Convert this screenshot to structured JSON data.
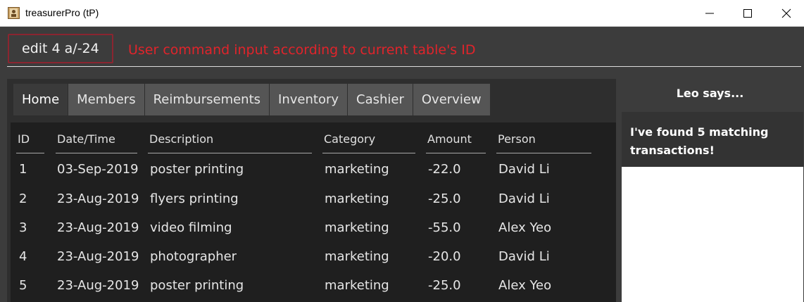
{
  "window": {
    "title": "treasurerPro (tP)",
    "icons": [
      "app-icon",
      "minimize-icon",
      "maximize-icon",
      "close-icon"
    ]
  },
  "command": {
    "value": "edit 4 a/-24",
    "annotation": "User command input according to current table's ID"
  },
  "tabs": [
    {
      "label": "Home",
      "active": true
    },
    {
      "label": "Members",
      "active": false
    },
    {
      "label": "Reimbursements",
      "active": false
    },
    {
      "label": "Inventory",
      "active": false
    },
    {
      "label": "Cashier",
      "active": false
    },
    {
      "label": "Overview",
      "active": false
    }
  ],
  "table": {
    "columns": [
      "ID",
      "Date/Time",
      "Description",
      "Category",
      "Amount",
      "Person"
    ],
    "rows": [
      [
        "1",
        "03-Sep-2019",
        "poster printing",
        "marketing",
        "-22.0",
        "David Li"
      ],
      [
        "2",
        "23-Aug-2019",
        "flyers printing",
        "marketing",
        "-25.0",
        "David Li"
      ],
      [
        "3",
        "23-Aug-2019",
        "video filming",
        "marketing",
        "-55.0",
        "Alex Yeo"
      ],
      [
        "4",
        "23-Aug-2019",
        "photographer",
        "marketing",
        "-20.0",
        "David Li"
      ],
      [
        "5",
        "23-Aug-2019",
        "poster printing",
        "marketing",
        "-25.0",
        "Alex Yeo"
      ]
    ]
  },
  "assistant": {
    "title": "Leo says...",
    "message": "I've found 5 matching transactions!"
  },
  "colors": {
    "annotation": "#e0242b",
    "input_border": "#8b2530",
    "background": "#3c3c3c",
    "table_background": "#1f1f1f"
  }
}
